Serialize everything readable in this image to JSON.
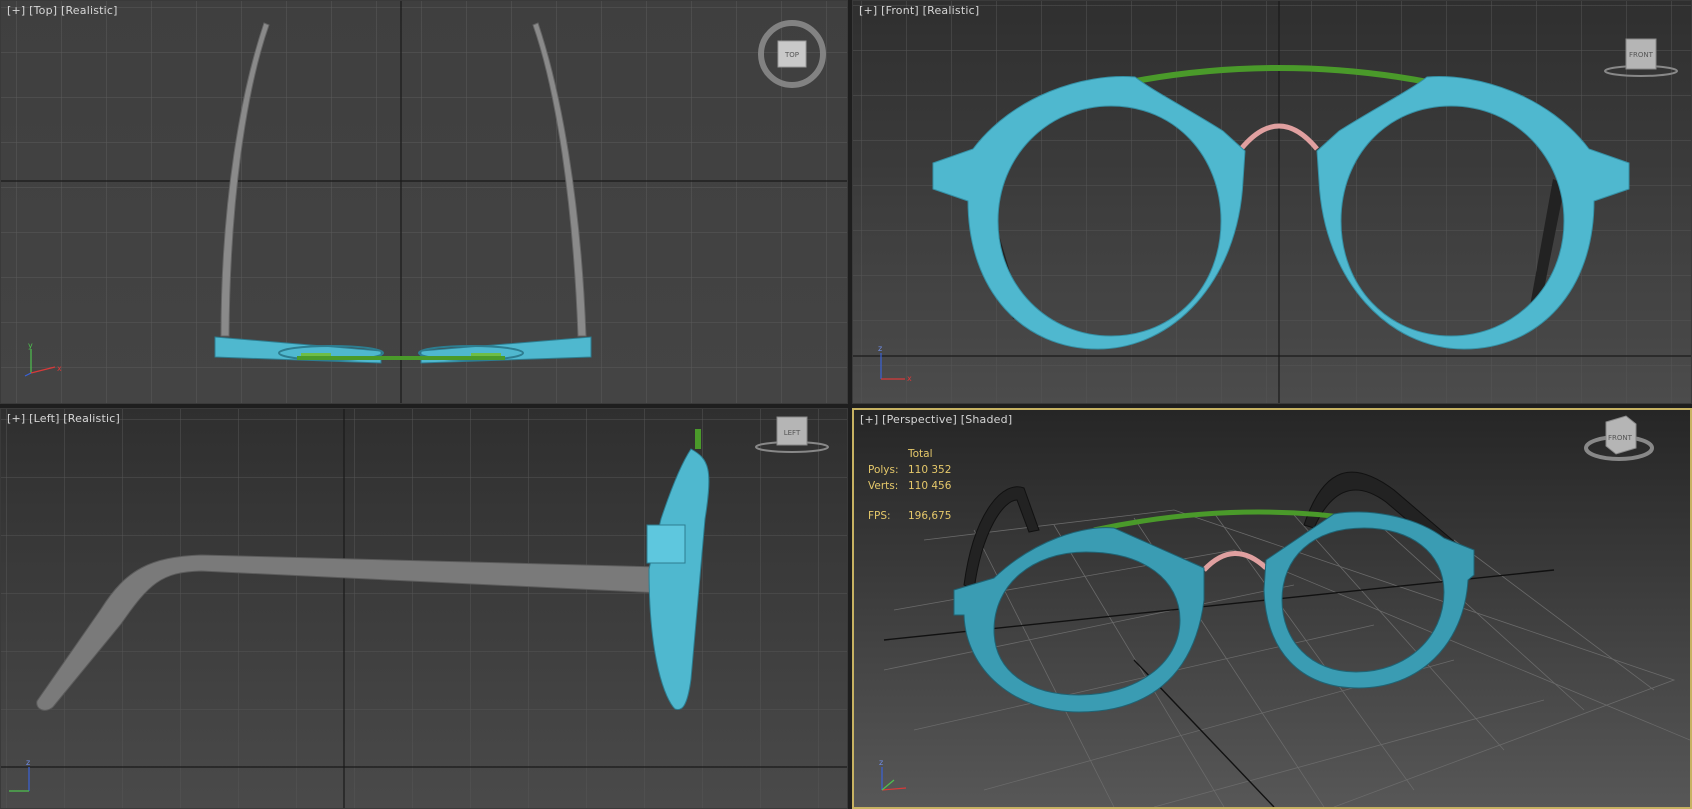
{
  "viewports": {
    "top": {
      "label_plus": "[+]",
      "label_view": "[Top]",
      "label_mode": "[Realistic]",
      "cube_face": "TOP"
    },
    "front": {
      "label_plus": "[+]",
      "label_view": "[Front]",
      "label_mode": "[Realistic]",
      "cube_face": "FRONT"
    },
    "left": {
      "label_plus": "[+]",
      "label_view": "[Left]",
      "label_mode": "[Realistic]",
      "cube_face": "LEFT"
    },
    "persp": {
      "label_plus": "[+]",
      "label_view": "[Perspective]",
      "label_mode": "[Shaded]",
      "cube_face": "FRONT"
    }
  },
  "stats": {
    "header": "Total",
    "polys_label": "Polys:",
    "polys_value": "110 352",
    "verts_label": "Verts:",
    "verts_value": "110 456",
    "fps_label": "FPS:",
    "fps_value": "196,675"
  },
  "axes": {
    "x": "x",
    "y": "y",
    "z": "z"
  },
  "colors": {
    "frame": "#4fb8cf",
    "bridge_bar": "#4a9a2a",
    "nose_bridge": "#e0a0a0",
    "temple_gray": "#8a8a8a",
    "temple_dark": "#222222",
    "active_border": "#c7b262",
    "stats_text": "#e5c86a"
  }
}
